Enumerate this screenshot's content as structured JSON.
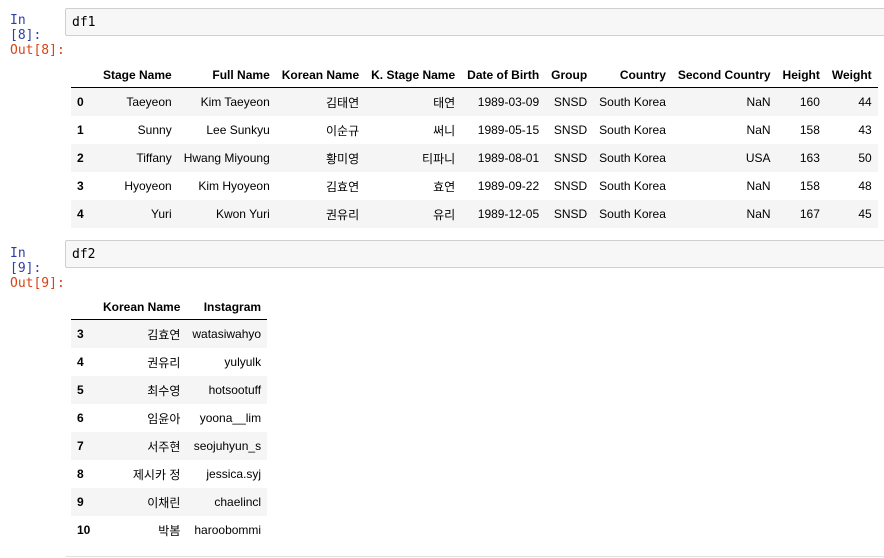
{
  "cells": [
    {
      "in_prompt": "In [8]:",
      "code": "df1",
      "out_prompt": "Out[8]:"
    },
    {
      "in_prompt": "In [9]:",
      "code": "df2",
      "out_prompt": "Out[9]:"
    }
  ],
  "df1": {
    "columns": [
      "Stage Name",
      "Full Name",
      "Korean Name",
      "K. Stage Name",
      "Date of Birth",
      "Group",
      "Country",
      "Second Country",
      "Height",
      "Weight"
    ],
    "rows": [
      {
        "index": "0",
        "values": [
          "Taeyeon",
          "Kim Taeyeon",
          "김태연",
          "태연",
          "1989-03-09",
          "SNSD",
          "South Korea",
          "NaN",
          "160",
          "44"
        ]
      },
      {
        "index": "1",
        "values": [
          "Sunny",
          "Lee Sunkyu",
          "이순규",
          "써니",
          "1989-05-15",
          "SNSD",
          "South Korea",
          "NaN",
          "158",
          "43"
        ]
      },
      {
        "index": "2",
        "values": [
          "Tiffany",
          "Hwang Miyoung",
          "황미영",
          "티파니",
          "1989-08-01",
          "SNSD",
          "South Korea",
          "USA",
          "163",
          "50"
        ]
      },
      {
        "index": "3",
        "values": [
          "Hyoyeon",
          "Kim Hyoyeon",
          "김효연",
          "효연",
          "1989-09-22",
          "SNSD",
          "South Korea",
          "NaN",
          "158",
          "48"
        ]
      },
      {
        "index": "4",
        "values": [
          "Yuri",
          "Kwon Yuri",
          "권유리",
          "유리",
          "1989-12-05",
          "SNSD",
          "South Korea",
          "NaN",
          "167",
          "45"
        ]
      }
    ]
  },
  "df2": {
    "columns": [
      "Korean Name",
      "Instagram"
    ],
    "rows": [
      {
        "index": "3",
        "values": [
          "김효연",
          "watasiwahyo"
        ]
      },
      {
        "index": "4",
        "values": [
          "권유리",
          "yulyulk"
        ]
      },
      {
        "index": "5",
        "values": [
          "최수영",
          "hotsootuff"
        ]
      },
      {
        "index": "6",
        "values": [
          "임윤아",
          "yoona__lim"
        ]
      },
      {
        "index": "7",
        "values": [
          "서주현",
          "seojuhyun_s"
        ]
      },
      {
        "index": "8",
        "values": [
          "제시카 정",
          "jessica.syj"
        ]
      },
      {
        "index": "9",
        "values": [
          "이채린",
          "chaelincl"
        ]
      },
      {
        "index": "10",
        "values": [
          "박봄",
          "haroobommi"
        ]
      }
    ]
  }
}
